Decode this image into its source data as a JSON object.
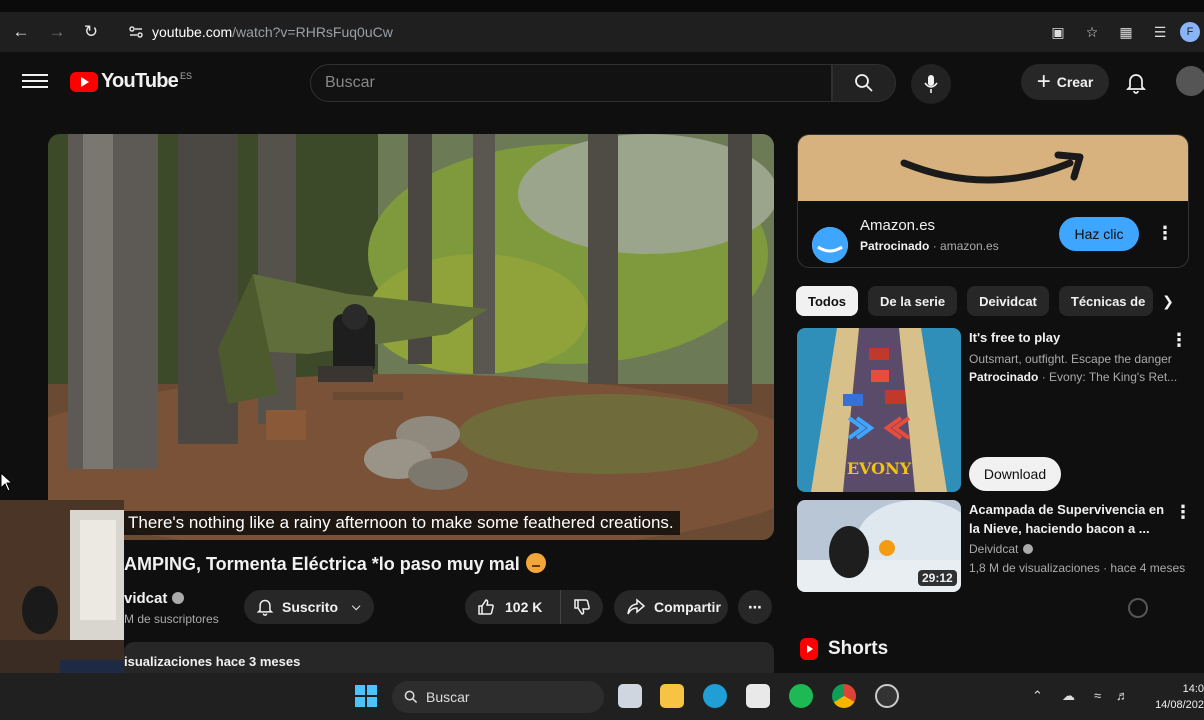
{
  "browser": {
    "url_domain": "youtube.com",
    "url_path": "/watch?v=RHRsFuq0uCw",
    "profile_initial": "F"
  },
  "youtube": {
    "logo_text": "YouTube",
    "logo_region": "ES",
    "search_placeholder": "Buscar",
    "create_label": "Crear"
  },
  "video": {
    "caption": "There's nothing like a rainy afternoon to make some feathered creations.",
    "title": "AMPING, Tormenta Eléctrica *lo paso muy mal",
    "channel": "vidcat",
    "subscribers": "M de suscriptores",
    "subscribe_label": "Suscrito",
    "likes": "102 K",
    "share_label": "Compartir",
    "description_line": "isualizaciones  hace 3 meses"
  },
  "ad": {
    "advertiser": "Amazon.es",
    "sponsored": "Patrocinado",
    "domain": "amazon.es",
    "cta": "Haz clic"
  },
  "chips": [
    "Todos",
    "De la serie",
    "Deividcat",
    "Técnicas de"
  ],
  "sidebar": {
    "sponsored_game": {
      "title": "It's free to play",
      "description": "Outsmart, outfight. Escape the danger",
      "sponsored": "Patrocinado",
      "advertiser": "Evony: The King's Ret...",
      "cta": "Download",
      "thumb_text": "EVONY"
    },
    "video_1": {
      "title": "Acampada de Supervivencia en la Nieve, haciendo bacon a ...",
      "channel": "Deividcat",
      "views": "1,8 M de visualizaciones",
      "age": "hace 4 meses",
      "duration": "29:12"
    },
    "shorts_label": "Shorts"
  },
  "taskbar": {
    "search_label": "Buscar",
    "time": "14:0",
    "date": "14/08/202"
  },
  "colors": {
    "background": "#0f0f0f",
    "brand_red": "#ff0000",
    "cta_blue": "#3ea6ff",
    "chip_bg": "#272727"
  }
}
